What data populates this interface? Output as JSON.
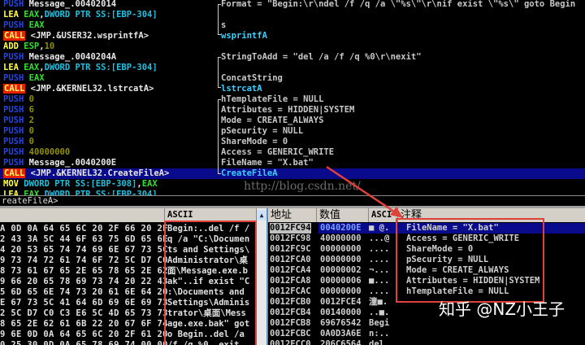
{
  "disasm": [
    {
      "tokens": [
        [
          "PUSH",
          "m-push"
        ],
        [
          " Message_.00402014",
          "op-w"
        ]
      ],
      "comment": "Format = \"Begin:\\r\\ndel /f /q /a \\\"%s\\\"\\r\\nif exist \\\"%s\\\" goto Begin",
      "fn": false
    },
    {
      "tokens": [
        [
          "LEA",
          "m-lea"
        ],
        [
          " EAX",
          "op-g"
        ],
        [
          ",",
          "op-w"
        ],
        [
          "DWORD PTR SS:[EBP-304]",
          "op-c"
        ]
      ],
      "comment": "",
      "fn": false
    },
    {
      "tokens": [
        [
          "PUSH",
          "m-push"
        ],
        [
          " EAX",
          "op-g"
        ]
      ],
      "comment": "s",
      "fn": false
    },
    {
      "tokens": [
        [
          "CALL",
          "m-call"
        ],
        [
          " <JMP.&USER32.wsprintfA>",
          "op-w"
        ]
      ],
      "comment": "wsprintfA",
      "fn": true
    },
    {
      "tokens": [
        [
          "ADD",
          "m-add"
        ],
        [
          " ESP",
          "op-g"
        ],
        [
          ",",
          "op-w"
        ],
        [
          "10",
          "op-n"
        ]
      ],
      "comment": "",
      "fn": false
    },
    {
      "tokens": [
        [
          "PUSH",
          "m-push"
        ],
        [
          " Message_.0040204A",
          "op-w"
        ]
      ],
      "comment": "StringToAdd = \"del /a /f /q %0\\r\\nexit\"",
      "fn": false
    },
    {
      "tokens": [
        [
          "LEA",
          "m-lea"
        ],
        [
          " EAX",
          "op-g"
        ],
        [
          ",",
          "op-w"
        ],
        [
          "DWORD PTR SS:[EBP-304]",
          "op-c"
        ]
      ],
      "comment": "",
      "fn": false
    },
    {
      "tokens": [
        [
          "PUSH",
          "m-push"
        ],
        [
          " EAX",
          "op-g"
        ]
      ],
      "comment": "ConcatString",
      "fn": false
    },
    {
      "tokens": [
        [
          "CALL",
          "m-call"
        ],
        [
          " <JMP.&KERNEL32.lstrcatA>",
          "op-w"
        ]
      ],
      "comment": "lstrcatA",
      "fn": true
    },
    {
      "tokens": [
        [
          "PUSH",
          "m-push"
        ],
        [
          " 0",
          "op-n"
        ]
      ],
      "comment": "hTemplateFile = NULL",
      "fn": false
    },
    {
      "tokens": [
        [
          "PUSH",
          "m-push"
        ],
        [
          " 6",
          "op-n"
        ]
      ],
      "comment": "Attributes = HIDDEN|SYSTEM",
      "fn": false
    },
    {
      "tokens": [
        [
          "PUSH",
          "m-push"
        ],
        [
          " 2",
          "op-n"
        ]
      ],
      "comment": "Mode = CREATE_ALWAYS",
      "fn": false
    },
    {
      "tokens": [
        [
          "PUSH",
          "m-push"
        ],
        [
          " 0",
          "op-n"
        ]
      ],
      "comment": "pSecurity = NULL",
      "fn": false
    },
    {
      "tokens": [
        [
          "PUSH",
          "m-push"
        ],
        [
          " 0",
          "op-n"
        ]
      ],
      "comment": "ShareMode = 0",
      "fn": false
    },
    {
      "tokens": [
        [
          "PUSH",
          "m-push"
        ],
        [
          " 40000000",
          "op-n"
        ]
      ],
      "comment": "Access = GENERIC_WRITE",
      "fn": false
    },
    {
      "tokens": [
        [
          "PUSH",
          "m-push"
        ],
        [
          " Message_.0040200E",
          "op-w"
        ]
      ],
      "comment": "FileName = \"X.bat\"",
      "fn": false
    },
    {
      "tokens": [
        [
          "CALL",
          "m-call"
        ],
        [
          " <JMP.&KERNEL32.CreateFileA>",
          "op-w"
        ]
      ],
      "comment": "CreateFileA",
      "fn": true,
      "selected": true
    },
    {
      "tokens": [
        [
          "MOV",
          "m-mov"
        ],
        [
          " DWORD PTR SS:[EBP-308]",
          "op-c"
        ],
        [
          ",",
          "op-w"
        ],
        [
          "EAX",
          "op-g"
        ]
      ],
      "comment": "",
      "fn": false
    },
    {
      "tokens": [
        [
          "LEA",
          "m-lea"
        ],
        [
          " EAX",
          "op-g"
        ],
        [
          ",",
          "op-w"
        ],
        [
          "DWORD PTR SS:[EBP-304]",
          "op-c"
        ]
      ],
      "comment": "",
      "fn": false
    }
  ],
  "status": "reateFileA>",
  "watermark": "http://blog.csdn.net/",
  "dump": {
    "ascii_header": "ASCII",
    "rows": [
      {
        "hex": "A 0D 0A 64 65 6C 20 2F 66 20 2F",
        "ascii": "Begin:..del /f /"
      },
      {
        "hex": "2 43 3A 5C 44 6F 63 75 6D 65 6E",
        "ascii": "q /a \"C:\\Documen"
      },
      {
        "hex": "4 20 53 65 74 74 69 6E 67 73 5C",
        "ascii": "ts and Settings\\"
      },
      {
        "hex": "9 73 74 72 61 74 6F 72 5C D7 C0",
        "ascii": "Administrator\\桌"
      },
      {
        "hex": "8 73 61 67 65 2E 65 78 65 2E 62",
        "ascii": "面\\Message.exe.b"
      },
      {
        "hex": "9 66 20 65 78 69 73 74 20 22 43",
        "ascii": "ak\"..if exist \"C"
      },
      {
        "hex": "5 6D 65 6E 74 73 20 61 6E 64 20",
        "ascii": ":\\Documents and "
      },
      {
        "hex": "E 67 73 5C 41 64 6D 69 6E 69 73",
        "ascii": "Settings\\Adminis"
      },
      {
        "hex": "2 5C D7 C0 C3 E6 5C 4D 65 73 73",
        "ascii": "trator\\桌面\\Mess"
      },
      {
        "hex": "8 65 2E 62 61 6B 22 20 67 6F 74",
        "ascii": "age.exe.bak\" got"
      },
      {
        "hex": "9 6E 0D 0A 64 65 6C 20 2F 61 20",
        "ascii": "o Begin..del /a "
      },
      {
        "hex": "0 25 30 0D 0A 65 78 69 74 00 00",
        "ascii": "/f /q %0..exit"
      }
    ]
  },
  "stack": {
    "headers": {
      "address": "地址",
      "value": "数值",
      "ascii": "ASCI",
      "comment": "注释"
    },
    "rows": [
      {
        "address": "0012FC94",
        "value": "0040200E",
        "ascii": "■ @.",
        "comment": "FileName = \"X.bat\"",
        "selected": true
      },
      {
        "address": "0012FC98",
        "value": "40000000",
        "ascii": "...@",
        "comment": "Access = GENERIC_WRITE"
      },
      {
        "address": "0012FC9C",
        "value": "00000000",
        "ascii": "....",
        "comment": "ShareMode = 0"
      },
      {
        "address": "0012FCA0",
        "value": "00000000",
        "ascii": "....",
        "comment": "pSecurity = NULL"
      },
      {
        "address": "0012FCA4",
        "value": "00000002",
        "ascii": "¬...",
        "comment": "Mode = CREATE_ALWAYS"
      },
      {
        "address": "0012FCA8",
        "value": "00000006",
        "ascii": "■...",
        "comment": "Attributes = HIDDEN|SYSTEM"
      },
      {
        "address": "0012FCAC",
        "value": "00000000",
        "ascii": "....",
        "comment": "hTemplateFile = NULL"
      },
      {
        "address": "0012FCB0",
        "value": "0012FCE4",
        "ascii": "潼■.",
        "comment": ""
      },
      {
        "address": "0012FCB4",
        "value": "00140000",
        "ascii": "..■.",
        "comment": ""
      },
      {
        "address": "0012FCB8",
        "value": "69676542",
        "ascii": "Begi",
        "comment": ""
      },
      {
        "address": "0012FCBC",
        "value": "0A0D3A6E",
        "ascii": "n:..",
        "comment": ""
      },
      {
        "address": "0012FCC0",
        "value": "206C6564",
        "ascii": "del ",
        "comment": ""
      }
    ]
  },
  "overlay": {
    "zhihu_watermark": "知乎 @NZ小王子",
    "annotation_color": "#e0423a"
  }
}
